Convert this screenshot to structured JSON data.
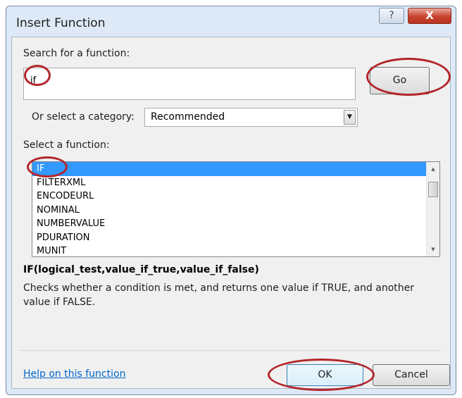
{
  "window": {
    "title": "Insert Function",
    "help_glyph": "?",
    "close_glyph": "X"
  },
  "search": {
    "label": "Search for a function:",
    "value": "if",
    "go_label": "Go"
  },
  "category": {
    "label": "Or select a category:",
    "value": "Recommended"
  },
  "functions": {
    "label": "Select a function:",
    "items": [
      "IF",
      "FILTERXML",
      "ENCODEURL",
      "NOMINAL",
      "NUMBERVALUE",
      "PDURATION",
      "MUNIT"
    ],
    "selected_index": 0
  },
  "details": {
    "syntax": "IF(logical_test,value_if_true,value_if_false)",
    "description": "Checks whether a condition is met, and returns one value if TRUE, and another value if FALSE."
  },
  "footer": {
    "help_link": "Help on this function",
    "ok_label": "OK",
    "cancel_label": "Cancel"
  },
  "colors": {
    "highlight_ring": "#b3262a",
    "selection": "#3399ff",
    "link": "#0066cc"
  }
}
